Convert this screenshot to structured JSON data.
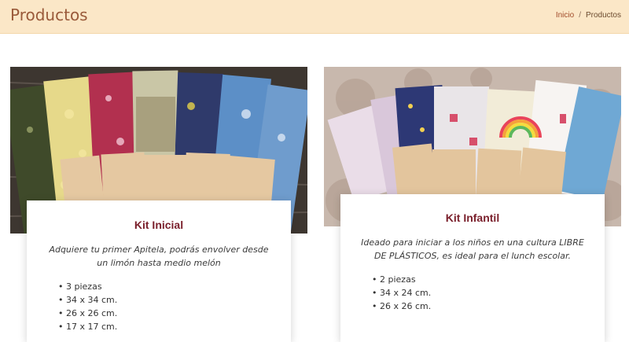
{
  "header": {
    "title": "Productos",
    "breadcrumb": {
      "home": "Inicio",
      "separator": "/",
      "current": "Productos"
    }
  },
  "products": [
    {
      "image_alt": "Wraps de tela estampada con etiqueta Apitela",
      "title": "Kit Inicial",
      "description": "Adquiere tu primer Apitela, podrás envolver desde un limón hasta medio melón",
      "features": [
        "3 piezas",
        "34 x 34 cm.",
        "26 x 26 cm.",
        "17 x 17 cm."
      ]
    },
    {
      "image_alt": "Wraps infantiles con etiqueta Apitela",
      "title": "Kit Infantil",
      "description": "Ideado para iniciar a los niños en una cultura LIBRE DE PLÁSTICOS, es ideal para el lunch escolar.",
      "features": [
        "2 piezas",
        "34 x 24 cm.",
        "26 x 26 cm."
      ]
    }
  ],
  "colors": {
    "header_bg": "#fbe7c7",
    "title": "#9a5a3a",
    "card_title": "#7a1f2b",
    "link": "#a24c2b"
  }
}
